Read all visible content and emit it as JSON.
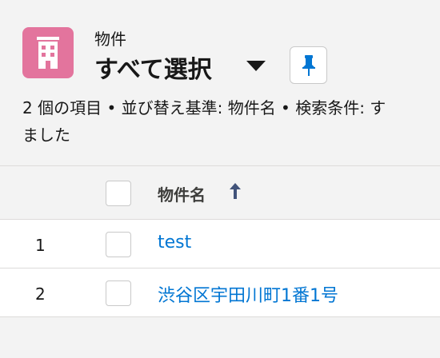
{
  "header": {
    "object_name": "物件",
    "list_view_name": "すべて選択",
    "summary_line1": "2 個の項目 • 並び替え基準: 物件名 • 検索条件: す",
    "summary_line2": "ました"
  },
  "table": {
    "columns": [
      {
        "label": "物件名",
        "sort": "ascending"
      }
    ],
    "rows": [
      {
        "num": "1",
        "name": "test"
      },
      {
        "num": "2",
        "name": "渋谷区宇田川町1番1号"
      }
    ]
  },
  "colors": {
    "object_icon": "#e3749d",
    "link": "#0176d3",
    "background": "#f3f3f3"
  },
  "icons": {
    "object": "building-icon",
    "pin": "pin-icon",
    "sort": "arrow-up-icon",
    "list_view_switcher": "caret-down-icon"
  }
}
